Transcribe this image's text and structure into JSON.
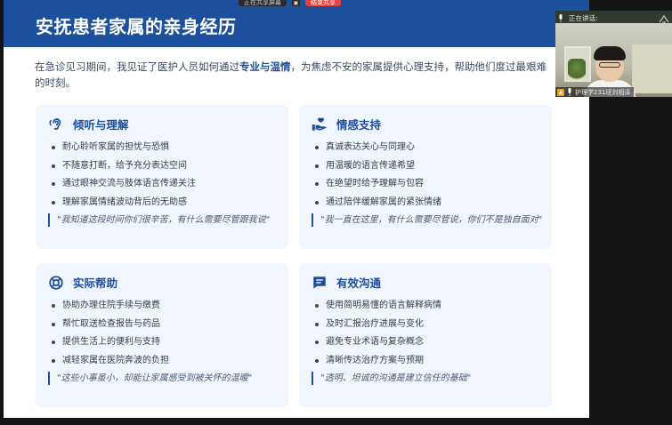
{
  "share_bar": {
    "status_text": "正在共享屏幕",
    "stop_label": "结束共享"
  },
  "slide": {
    "title": "安抚患者家属的亲身经历",
    "intro": {
      "part1": "在急诊见习期间，我见证了医护人员如何通过",
      "highlight": "专业与温情",
      "part2": "，为焦虑不安的家属提供心理支持，帮助他们度过最艰难的时刻。"
    },
    "cards": [
      {
        "icon": "ear-icon",
        "title": "倾听与理解",
        "items": [
          "耐心聆听家属的担忧与恐惧",
          "不随意打断，给予充分表达空间",
          "通过眼神交流与肢体语言传递关注",
          "理解家属情绪波动背后的无助感"
        ],
        "quote": "\"我知道这段时间你们很辛苦，有什么需要尽管跟我说\""
      },
      {
        "icon": "hand-heart-icon",
        "title": "情感支持",
        "items": [
          "真诚表达关心与同理心",
          "用温暖的语言传递希望",
          "在绝望时给予理解与包容",
          "通过陪伴缓解家属的紧张情绪"
        ],
        "quote": "\"我一直在这里，有什么需要尽管说，你们不是独自面对\""
      },
      {
        "icon": "lifebuoy-icon",
        "title": "实际帮助",
        "items": [
          "协助办理住院手续与缴费",
          "帮忙取送检查报告与药品",
          "提供生活上的便利与支持",
          "减轻家属在医院奔波的负担"
        ],
        "quote": "\"这些小事虽小，却能让家属感受到被关怀的温暖\""
      },
      {
        "icon": "chat-icon",
        "title": "有效沟通",
        "items": [
          "使用简明易懂的语言解释病情",
          "及时汇报治疗进展与变化",
          "避免专业术语与复杂概念",
          "清晰传达治疗方案与预期"
        ],
        "quote": "\"透明、坦诚的沟通是建立信任的基础\""
      }
    ]
  },
  "video_panel": {
    "speaking_label": "正在讲话:",
    "participant_name": "护理学231班刘相泽"
  },
  "colors": {
    "header": "#1c4f9c",
    "card_bg": "#f1f6fd",
    "accent": "#1c4f9c",
    "stop_red": "#e0433b"
  }
}
